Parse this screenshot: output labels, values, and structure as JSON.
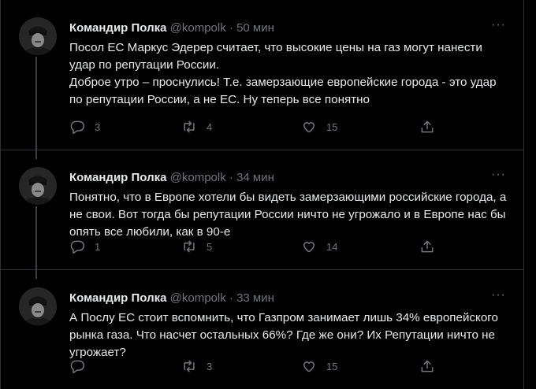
{
  "tweets": [
    {
      "author": "Командир Полка",
      "handle": "@kompolk",
      "separator": "·",
      "time": "50 мин",
      "more": "···",
      "text": "Посол ЕС Маркус Эдерер считает, что высокие цены на газ могут нанести удар по репутации России.\nДоброе утро – проснулись! Т.е. замерзающие европейские города - это удар по репутации России, а не ЕС. Ну теперь все понятно",
      "replies": "3",
      "retweets": "4",
      "likes": "15"
    },
    {
      "author": "Командир Полка",
      "handle": "@kompolk",
      "separator": "·",
      "time": "34 мин",
      "more": "···",
      "text": "Понятно, что в Европе хотели бы видеть замерзающими российские города, а не свои. Вот тогда бы репутации России ничто не угрожало и в Европе нас бы опять все любили, как в 90-е",
      "replies": "1",
      "retweets": "5",
      "likes": "14"
    },
    {
      "author": "Командир Полка",
      "handle": "@kompolk",
      "separator": "·",
      "time": "33 мин",
      "more": "···",
      "text": "А Послу ЕС стоит вспомнить, что Газпром занимает лишь 34% европейского рынка газа. Что насчет остальных 66%? Где же они? Их Репутации ничто не угрожает?",
      "replies": "",
      "retweets": "3",
      "likes": "15"
    }
  ],
  "icons": {
    "reply": "speech-bubble",
    "retweet": "two-arrows-loop",
    "like": "heart-outline",
    "share": "upload-arrow"
  },
  "colors": {
    "background": "#000000",
    "text": "#e7e9ea",
    "secondary": "#71767b",
    "divider": "#2f3336"
  }
}
